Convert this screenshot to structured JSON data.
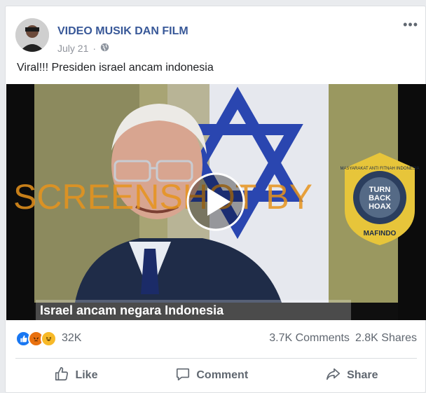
{
  "post": {
    "page_name": "VIDEO MUSIK DAN FILM",
    "date": "July 21",
    "separator": "·",
    "privacy_icon": "globe-icon",
    "more_label": "•••",
    "text": "Viral!!! Presiden israel ancam indonesia"
  },
  "video": {
    "caption": "Israel ancam negara Indonesia",
    "watermark": "SCREENSHOT BY",
    "badge": {
      "ring_top": "MASYARAKAT ANTI FITNAH INDONESIA",
      "ring_bottom": "MAFINDO",
      "center_lines": [
        "TURN",
        "BACK",
        "HOAX"
      ]
    },
    "play_icon": "play-icon"
  },
  "stats": {
    "reactions": [
      "like-reaction-icon",
      "angry-reaction-icon",
      "haha-reaction-icon"
    ],
    "reaction_count": "32K",
    "comments": "3.7K Comments",
    "shares": "2.8K Shares"
  },
  "actions": {
    "like": "Like",
    "comment": "Comment",
    "share": "Share"
  },
  "colors": {
    "link": "#385898",
    "text": "#1c1e21",
    "muted": "#606770",
    "like_blue": "#1877f2",
    "angry": "#e9710f",
    "haha": "#f7b928",
    "watermark_orange": "#e8941c",
    "badge_gold": "#e7c53a"
  }
}
